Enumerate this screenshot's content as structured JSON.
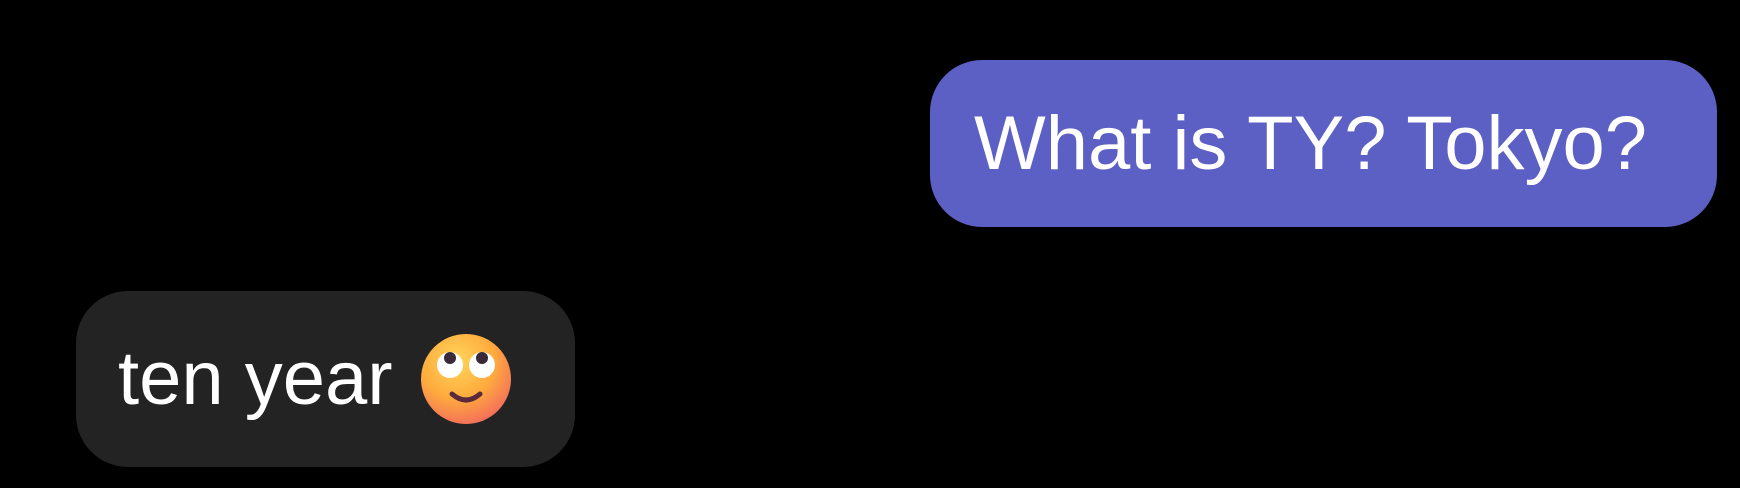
{
  "conversation": {
    "messages": [
      {
        "direction": "sent",
        "text": "What is TY? Tokyo?",
        "bubble_color": "#5c5fc4"
      },
      {
        "direction": "received",
        "text": "ten year",
        "emoji": "face-with-rolling-eyes",
        "bubble_color": "#232323"
      }
    ]
  },
  "theme": {
    "background": "#000000",
    "text_color": "#ffffff"
  }
}
